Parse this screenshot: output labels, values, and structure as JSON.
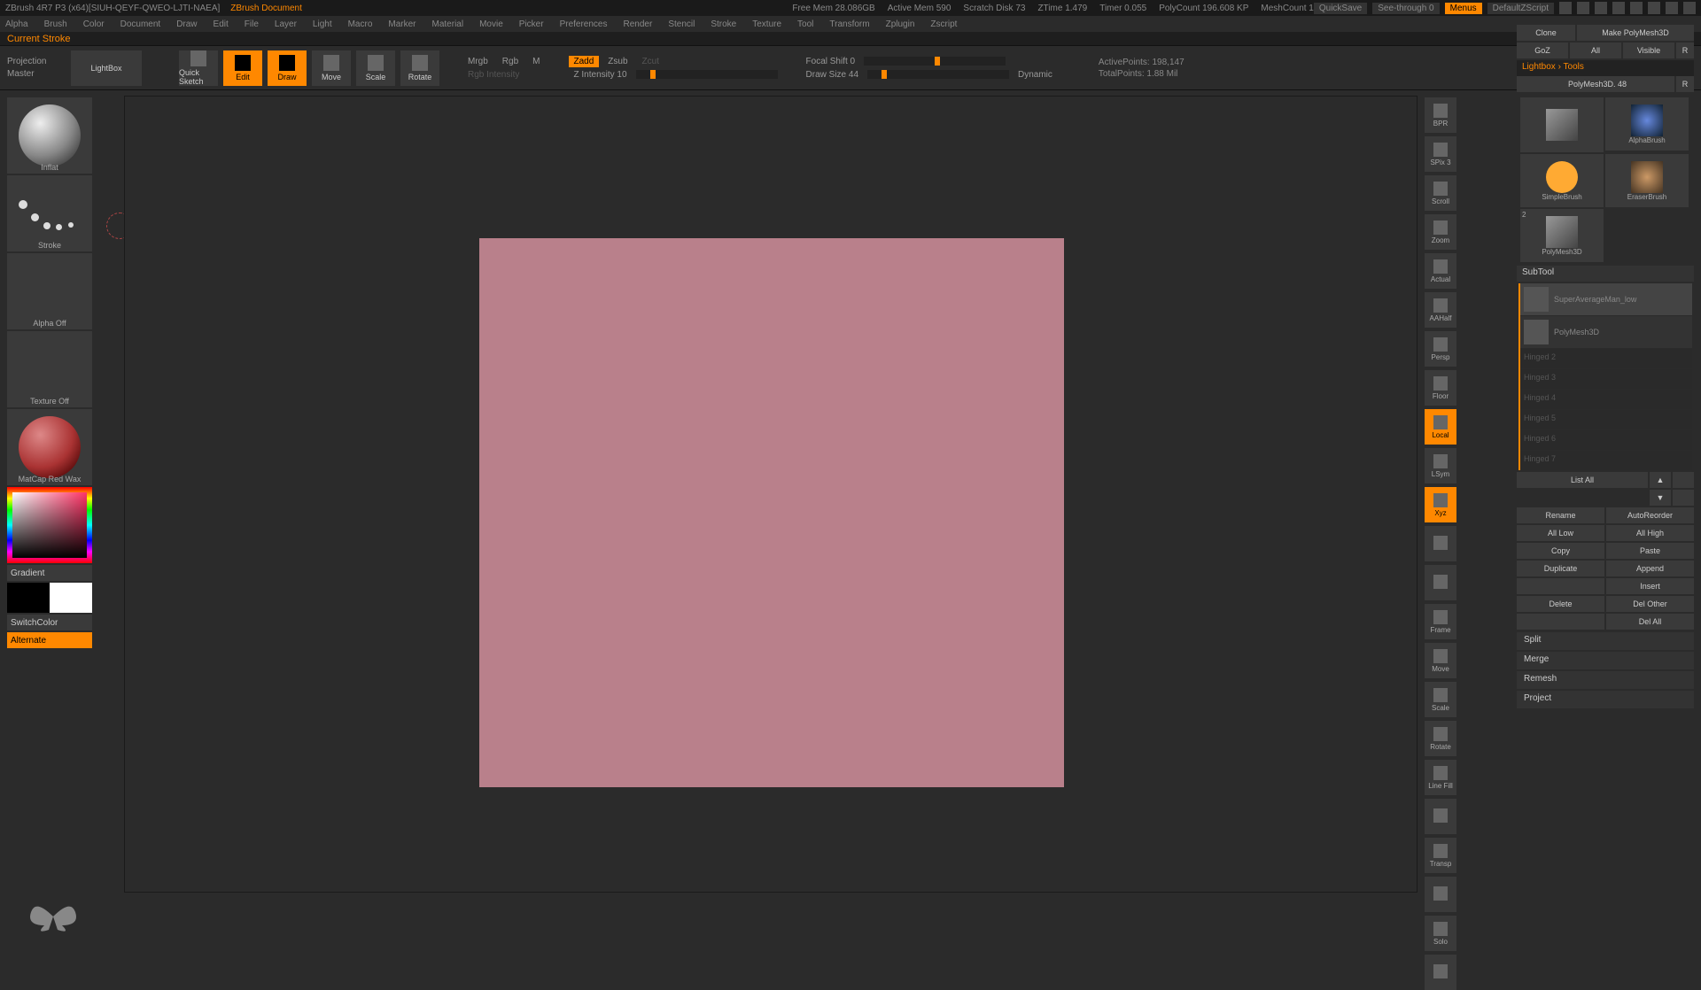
{
  "titlebar": {
    "app": "ZBrush 4R7 P3  (x64)[SIUH-QEYF-QWEO-LJTI-NAEA]",
    "doc": "ZBrush Document",
    "stats": {
      "mem": "Free Mem 28.086GB",
      "active": "Active Mem 590",
      "scratch": "Scratch Disk 73",
      "ztime": "ZTime 1.479",
      "timer": "Timer 0.055",
      "poly": "PolyCount 196.608 KP",
      "mesh": "MeshCount 1"
    },
    "quicksave": "QuickSave",
    "see": "See-through  0",
    "menus": "Menus",
    "script": "DefaultZScript"
  },
  "menu": [
    "Alpha",
    "Brush",
    "Color",
    "Document",
    "Draw",
    "Edit",
    "File",
    "Layer",
    "Light",
    "Macro",
    "Marker",
    "Material",
    "Movie",
    "Picker",
    "Preferences",
    "Render",
    "Stencil",
    "Stroke",
    "Texture",
    "Tool",
    "Transform",
    "Zplugin",
    "Zscript"
  ],
  "status": "Current Stroke",
  "toolbar": {
    "proj": "Projection Master",
    "lightbox": "LightBox",
    "quicksketch": "Quick Sketch",
    "edit": "Edit",
    "draw": "Draw",
    "move": "Move",
    "scale": "Scale",
    "rotate": "Rotate",
    "mrgb": "Mrgb",
    "rgb": "Rgb",
    "m": "M",
    "rgbint": "Rgb Intensity",
    "zadd": "Zadd",
    "zsub": "Zsub",
    "zcut": "Zcut",
    "zint": "Z Intensity 10",
    "focal": "Focal Shift 0",
    "drawsize": "Draw Size 44",
    "dynamic": "Dynamic",
    "active_pts": "ActivePoints: 198,147",
    "total_pts": "TotalPoints: 1.88 Mil"
  },
  "left": {
    "brush": "Inflat",
    "stroke": "Stroke",
    "alpha": "Alpha Off",
    "texture": "Texture Off",
    "material": "MatCap Red Wax",
    "gradient": "Gradient",
    "switch": "SwitchColor",
    "alternate": "Alternate"
  },
  "rstrip": [
    "BPR",
    "SPix 3",
    "Scroll",
    "Zoom",
    "Actual",
    "AAHalf",
    "Persp",
    "Floor",
    "Local",
    "LSym",
    "Xyz",
    "",
    "",
    "Frame",
    "Move",
    "Scale",
    "Rotate",
    "Line Fill",
    "",
    "Transp",
    "",
    "Solo",
    ""
  ],
  "rstrip_active": {
    "Local": true,
    "Xyz": true
  },
  "right": {
    "clone": "Clone",
    "make": "Make PolyMesh3D",
    "goz": "GoZ",
    "all": "All",
    "visible": "Visible",
    "r": "R",
    "lightbox": "Lightbox › Tools",
    "polymesh": "PolyMesh3D. 48",
    "polymesh_r": "R",
    "tools": [
      "SimpleBrush",
      "AlphaBrush",
      "SimpleBrush",
      "EraserBrush",
      "PolyMesh3D"
    ],
    "tool_num": "2",
    "subtool": "SubTool",
    "subs": [
      {
        "name": "SuperAverageMan_low"
      },
      {
        "name": "PolyMesh3D"
      }
    ],
    "extras": [
      "Hinged 2",
      "Hinged 3",
      "Hinged 4",
      "Hinged 5",
      "Hinged 6",
      "Hinged 7"
    ],
    "listall": "List All",
    "ops": [
      [
        "Rename",
        "AutoReorder"
      ],
      [
        "All Low",
        "All High"
      ],
      [
        "Copy",
        "Paste"
      ],
      [
        "Duplicate",
        "Append"
      ],
      [
        "",
        "Insert"
      ],
      [
        "Delete",
        "Del Other"
      ],
      [
        "",
        "Del All"
      ]
    ],
    "folds": [
      "Split",
      "Merge",
      "Remesh",
      "Project"
    ]
  }
}
